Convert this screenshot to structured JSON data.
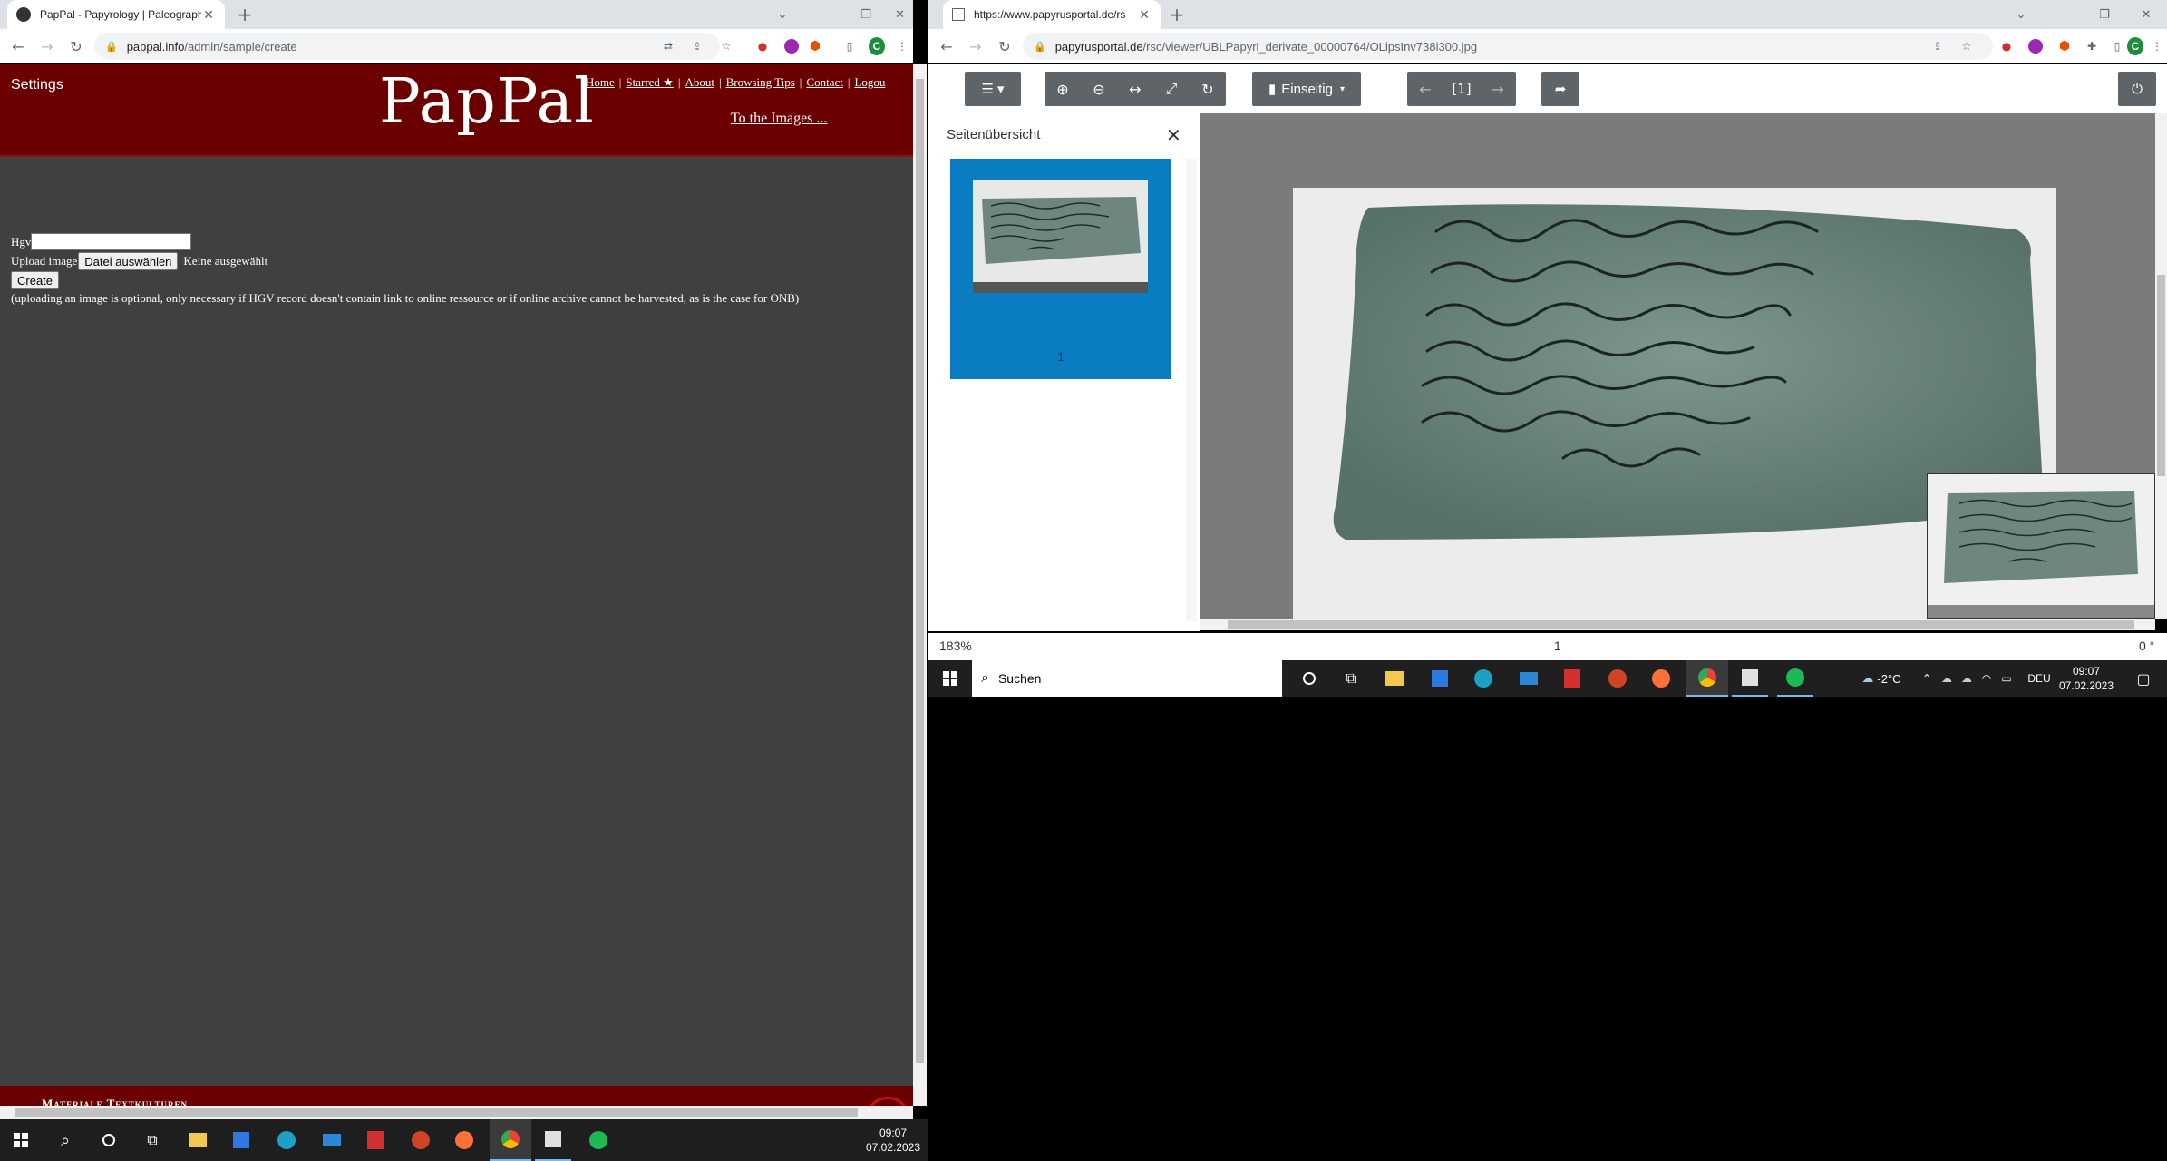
{
  "left_browser": {
    "tab_title": "PapPal - Papyrology | Paleograph",
    "url_host": "pappal.info",
    "url_path": "/admin/sample/create",
    "avatar_letter": "C"
  },
  "right_browser": {
    "tab_title": "https://www.papyrusportal.de/rs",
    "url_host": "papyrusportal.de",
    "url_path": "/rsc/viewer/UBLPapyri_derivate_00000764/OLipsInv738i300.jpg",
    "avatar_letter": "C"
  },
  "pappal": {
    "settings": "Settings",
    "logo": "PapPal",
    "nav": [
      "Home",
      "Starred ★",
      "About",
      "Browsing Tips",
      "Contact",
      "Logou"
    ],
    "to_images": "To the Images ...",
    "form": {
      "hgv_label": "Hgv",
      "hgv_value": "",
      "upload_label": "Upload image",
      "file_button": "Datei auswählen",
      "file_status": "Keine ausgewählt",
      "create_button": "Create",
      "note": "(uploading an image is optional, only necessary if HGV record doesn't contain link to online ressource or if online archive cannot be harvested, as is the case for ONB)"
    },
    "footer_text": "Materiale Textkulturen"
  },
  "viewer": {
    "layout_button": "Einseitig",
    "page_indicator": "[1]",
    "sidebar_title": "Seitenübersicht",
    "thumb_number": "1",
    "zoom": "183%",
    "page": "1",
    "rotation": "0 °"
  },
  "taskbar_left": {
    "time": "09:07",
    "date": "07.02.2023"
  },
  "taskbar_right": {
    "search_placeholder": "Suchen",
    "weather": "-2°C",
    "language": "DEU",
    "time": "09:07",
    "date": "07.02.2023"
  },
  "colors": {
    "pappal_header": "#6b0000",
    "pappal_body": "#404040",
    "viewer_accent": "#0a7cc1",
    "viewer_button": "#5e6468"
  }
}
